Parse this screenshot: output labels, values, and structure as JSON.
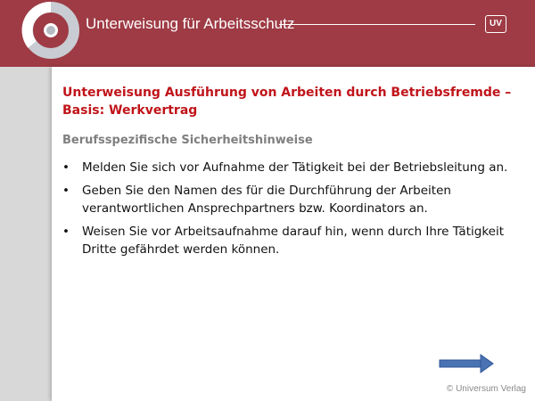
{
  "header": {
    "title": "Unterweisung für Arbeitsschutz",
    "logo_badge": "UV",
    "bg_color": "#9e3b45"
  },
  "slide": {
    "title": "Unterweisung Ausführung von Arbeiten durch Betriebsfremde – Basis: Werkvertrag",
    "subtitle": "Berufsspezifische Sicherheitshinweise",
    "bullets": [
      "Melden Sie sich vor Aufnahme der Tätigkeit bei der Betriebsleitung an.",
      "Geben Sie den Namen des für die Durchführung der Arbeiten verantwortlichen Ansprechpartners bzw. Koordinators an.",
      "Weisen Sie vor Arbeitsaufnahme darauf hin, wenn durch Ihre Tätigkeit Dritte gefährdet werden können."
    ],
    "bullet_symbol": "•",
    "title_color": "#c0141a",
    "subtitle_color": "#7f7f7f"
  },
  "navigation": {
    "next_icon": "right-arrow-icon",
    "arrow_color": "#4a73b4"
  },
  "footer": {
    "copyright": "© Universum Verlag"
  }
}
